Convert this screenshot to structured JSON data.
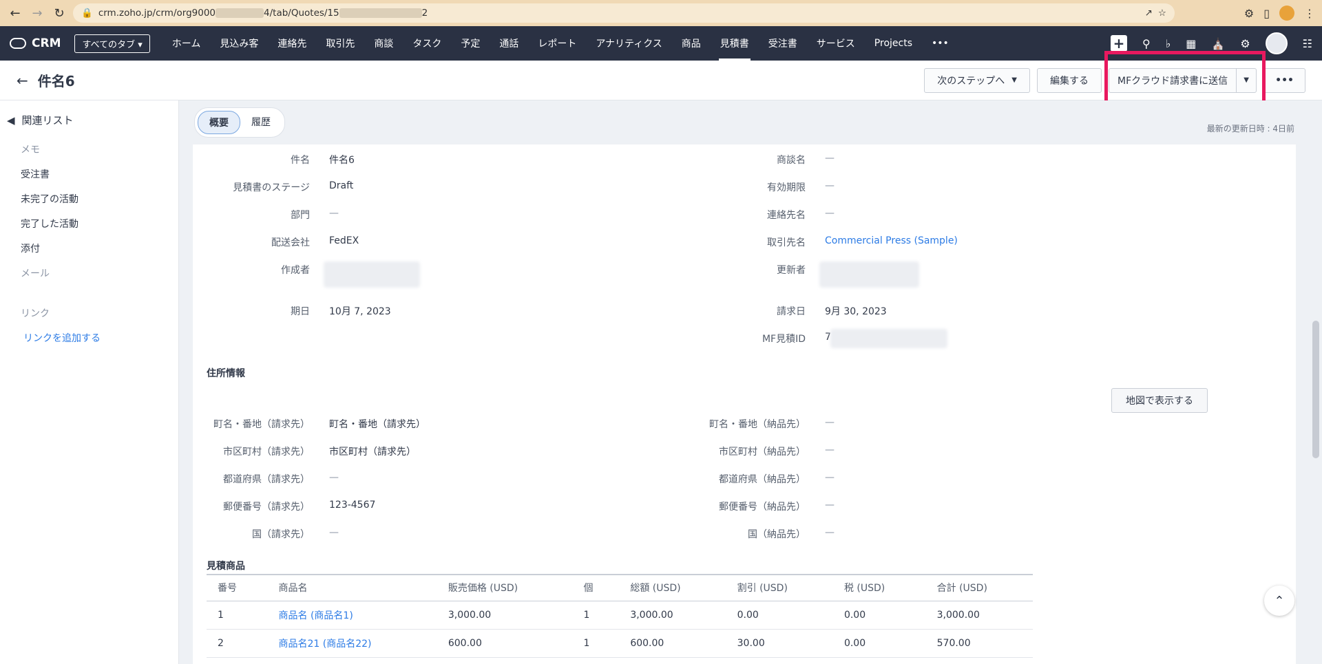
{
  "browser": {
    "url_prefix": "crm.zoho.jp/crm/org9000",
    "url_mid": "4/tab/Quotes/15",
    "url_suffix": "2"
  },
  "topnav": {
    "logo": "CRM",
    "all_tabs": "すべてのタブ",
    "items": [
      "ホーム",
      "見込み客",
      "連絡先",
      "取引先",
      "商談",
      "タスク",
      "予定",
      "通話",
      "レポート",
      "アナリティクス",
      "商品",
      "見積書",
      "受注書",
      "サービス",
      "Projects",
      "•••"
    ],
    "active_index": 11
  },
  "header": {
    "title": "件名6",
    "next_step": "次のステップへ",
    "edit": "編集する",
    "mf_send": "MFクラウド請求書に送信",
    "more": "•••"
  },
  "sidebar": {
    "title": "関連リスト",
    "items": [
      "メモ",
      "受注書",
      "未完了の活動",
      "完了した活動",
      "添付",
      "メール"
    ],
    "links_title": "リンク",
    "add_link": "リンクを追加する"
  },
  "tabs": {
    "overview": "概要",
    "history": "履歴"
  },
  "updated": "最新の更新日時 : 4日前",
  "fields_left": [
    {
      "label": "件名",
      "value": "件名6"
    },
    {
      "label": "見積書のステージ",
      "value": "Draft"
    },
    {
      "label": "部門",
      "value": "—"
    },
    {
      "label": "配送会社",
      "value": "FedEX"
    },
    {
      "label": "作成者",
      "value": ""
    },
    {
      "label": "期日",
      "value": "10月 7, 2023"
    }
  ],
  "fields_right": [
    {
      "label": "商談名",
      "value": "—"
    },
    {
      "label": "有効期限",
      "value": "—"
    },
    {
      "label": "連絡先名",
      "value": "—"
    },
    {
      "label": "取引先名",
      "value": "Commercial Press (Sample)"
    },
    {
      "label": "更新者",
      "value": ""
    },
    {
      "label": "請求日",
      "value": "9月 30, 2023"
    },
    {
      "label": "MF見積ID",
      "value": "7"
    }
  ],
  "address": {
    "title": "住所情報",
    "map_button": "地図で表示する",
    "left": [
      {
        "label": "町名・番地（請求先）",
        "value": "町名・番地（請求先）"
      },
      {
        "label": "市区町村（請求先）",
        "value": "市区町村（請求先）"
      },
      {
        "label": "都道府県（請求先）",
        "value": "—"
      },
      {
        "label": "郵便番号（請求先）",
        "value": "123-4567"
      },
      {
        "label": "国（請求先）",
        "value": "—"
      }
    ],
    "right": [
      {
        "label": "町名・番地（納品先）",
        "value": "—"
      },
      {
        "label": "市区町村（納品先）",
        "value": "—"
      },
      {
        "label": "都道府県（納品先）",
        "value": "—"
      },
      {
        "label": "郵便番号（納品先）",
        "value": "—"
      },
      {
        "label": "国（納品先）",
        "value": "—"
      }
    ]
  },
  "products": {
    "title": "見積商品",
    "columns": [
      "番号",
      "商品名",
      "販売価格 (USD)",
      "個",
      "総額 (USD)",
      "割引 (USD)",
      "税 (USD)",
      "合計 (USD)"
    ],
    "rows": [
      [
        "1",
        "商品名 (商品名1)",
        "3,000.00",
        "1",
        "3,000.00",
        "0.00",
        "0.00",
        "3,000.00"
      ],
      [
        "2",
        "商品名21 (商品名22)",
        "600.00",
        "1",
        "600.00",
        "30.00",
        "0.00",
        "570.00"
      ]
    ]
  },
  "colors": {
    "highlight": "#e8195f",
    "nav_bg": "#2a3143",
    "link": "#2c7be5"
  }
}
